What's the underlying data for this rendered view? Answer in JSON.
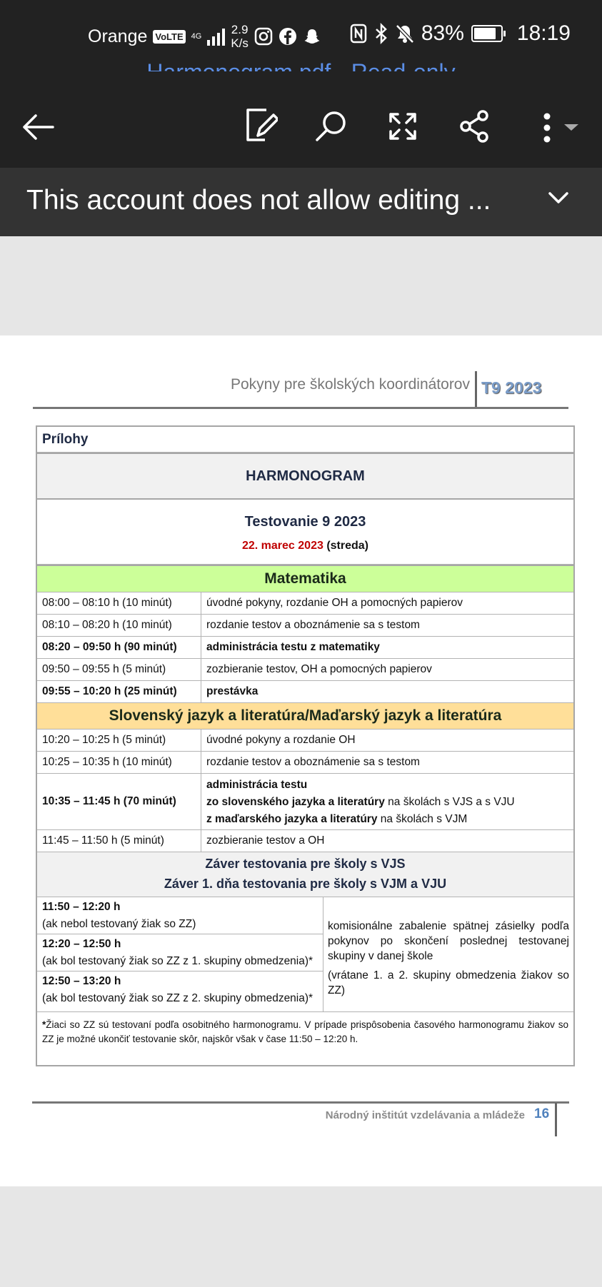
{
  "status_bar": {
    "carrier": "Orange",
    "volte": "VoLTE",
    "network": "4G",
    "speed_value": "2.9",
    "speed_unit": "K/s",
    "battery": "83%",
    "time": "18:19"
  },
  "window": {
    "title": "Harmonogram.pdf - Read-only"
  },
  "toolbar": {
    "icons": [
      "back-arrow-icon",
      "edit-icon",
      "search-icon",
      "fullscreen-icon",
      "share-icon",
      "more-icon"
    ]
  },
  "banner": {
    "text": "This account does not allow editing ..."
  },
  "document": {
    "header_text": "Pokyny pre školských koordinátorov",
    "header_code": "T9 2023",
    "prilohy": "Prílohy",
    "harmonogram": "HARMONOGRAM",
    "testovanie": "Testovanie 9 2023",
    "date": "22. marec 2023",
    "weekday": "(streda)",
    "matematika": {
      "title": "Matematika",
      "rows": [
        {
          "time": "08:00 – 08:10 h (10 minút)",
          "desc": "úvodné pokyny, rozdanie OH a pomocných papierov",
          "bold": false
        },
        {
          "time": "08:10 – 08:20 h (10 minút)",
          "desc": "rozdanie testov a oboznámenie sa s testom",
          "bold": false
        },
        {
          "time": "08:20 – 09:50 h (90 minút)",
          "desc": "administrácia testu z matematiky",
          "bold": true
        },
        {
          "time": "09:50 – 09:55 h (5 minút)",
          "desc": "zozbieranie testov, OH a pomocných papierov",
          "bold": false
        },
        {
          "time": "09:55 – 10:20 h (25 minút)",
          "desc": "prestávka",
          "bold": true
        }
      ]
    },
    "slovensky": {
      "title": "Slovenský jazyk a literatúra/Maďarský jazyk a literatúra",
      "row1": {
        "time": "10:20 – 10:25 h (5 minút)",
        "desc": "úvodné pokyny a rozdanie OH"
      },
      "row2": {
        "time": "10:25 – 10:35 h (10 minút)",
        "desc": "rozdanie testov a oboznámenie sa s testom"
      },
      "row3": {
        "time": "10:35 – 11:45 h (70 minút)",
        "line1": "administrácia testu",
        "line2_bold": "zo slovenského jazyka a literatúry",
        "line2_rest": "na školách s VJS a s VJU",
        "line3_bold": "z maďarského jazyka a literatúry",
        "line3_rest": "na školách s VJM"
      },
      "row4": {
        "time": "11:45 – 11:50 h (5 minút)",
        "desc": "zozbieranie testov a OH"
      }
    },
    "zaver": {
      "line1": "Záver testovania pre školy s VJS",
      "line2": "Záver 1. dňa testovania pre školy s VJM a VJU"
    },
    "final_rows": [
      {
        "time": "11:50 – 12:20 h",
        "note": "(ak nebol testovaný žiak so ZZ)"
      },
      {
        "time": "12:20 – 12:50 h",
        "note": "(ak bol testovaný žiak so ZZ z 1. skupiny obmedzenia)*"
      },
      {
        "time": "12:50 – 13:20 h",
        "note": "(ak bol testovaný žiak so ZZ z 2. skupiny obmedzenia)*"
      }
    ],
    "final_desc1": "komisionálne zabalenie spätnej zásielky podľa pokynov po skončení poslednej testovanej skupiny v danej škole",
    "final_desc2": "(vrátane 1. a 2. skupiny obmedzenia žiakov so ZZ)",
    "footnote_star": "*",
    "footnote": "Žiaci so ZZ sú testovaní podľa osobitného harmonogramu. V prípade prispôsobenia časového harmonogramu žiakov so ZZ je možné ukončiť testovanie skôr, najskôr však v čase 11:50 – 12:20 h.",
    "footer_text": "Národný inštitút vzdelávania a mládeže",
    "page_number": "16"
  }
}
